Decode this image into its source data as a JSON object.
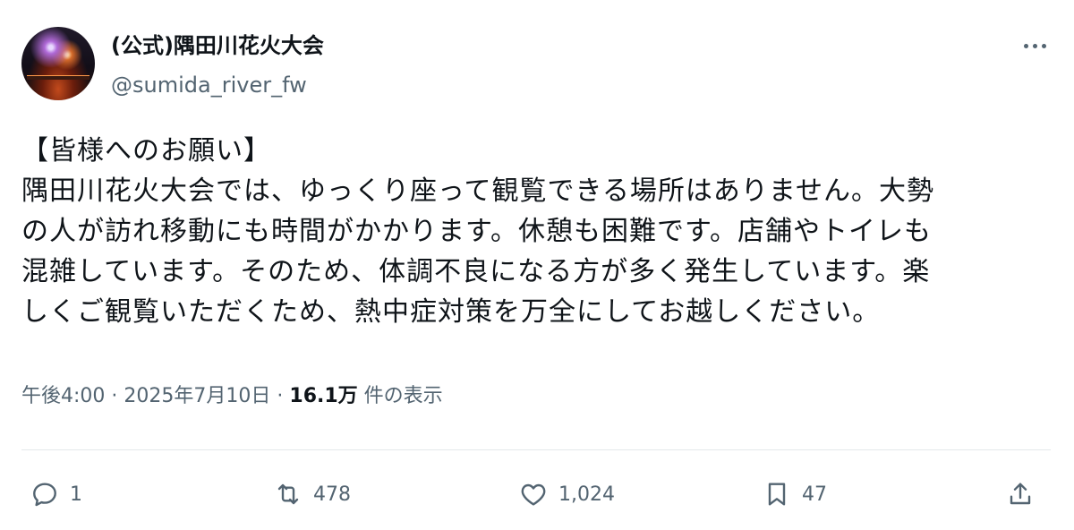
{
  "account": {
    "display_name": "(公式)隅田川花火大会",
    "handle": "@sumida_river_fw",
    "avatar_icon": "avatar-fireworks"
  },
  "post": {
    "lines": [
      "【皆様へのお願い】",
      "隅田川花火大会では、ゆっくり座って観覧できる場所はありません。大勢",
      "の人が訪れ移動にも時間がかかります。休憩も困難です。店舗やトイレも",
      "混雑しています。そのため、体調不良になる方が多く発生しています。楽",
      "しくご観覧いただくため、熱中症対策を万全にしてお越しください。"
    ]
  },
  "meta": {
    "time": "午後4:00",
    "separator": "·",
    "date": "2025年7月10日",
    "views_count": "16.1万",
    "views_label": "件の表示"
  },
  "actions": {
    "reply_count": "1",
    "repost_count": "478",
    "like_count": "1,024",
    "bookmark_count": "47"
  },
  "colors": {
    "text": "#0f1419",
    "secondary": "#536471",
    "divider": "#e4e8eb"
  }
}
